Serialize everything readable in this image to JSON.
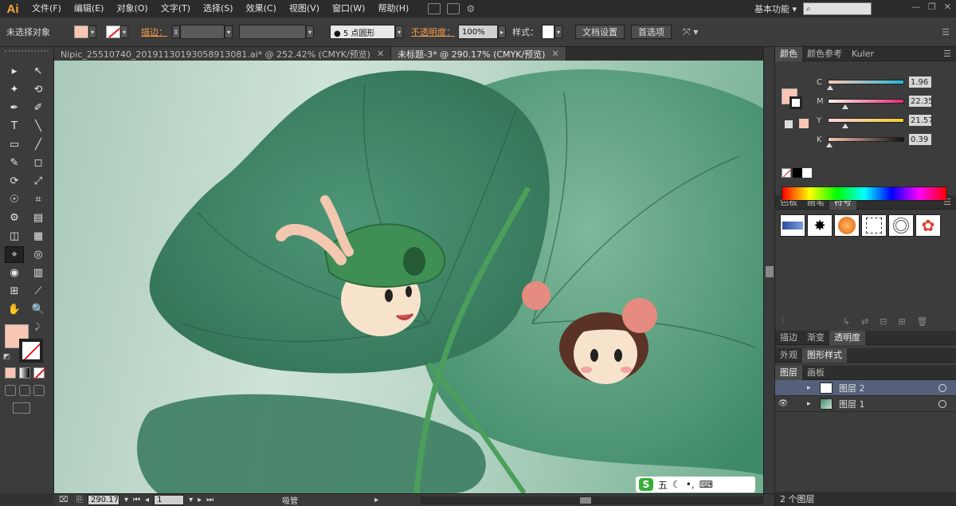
{
  "app": {
    "logo": "Ai",
    "menu": [
      "文件(F)",
      "编辑(E)",
      "对象(O)",
      "文字(T)",
      "选择(S)",
      "效果(C)",
      "视图(V)",
      "窗口(W)",
      "帮助(H)"
    ],
    "workspace": "基本功能",
    "window_buttons": [
      "—",
      "❐",
      "✕"
    ]
  },
  "control_bar": {
    "selection_status": "未选择对象",
    "stroke_label": "描边：",
    "brush_label": "● 5 点圆形",
    "opacity_label": "不透明度：",
    "opacity_value": "100%",
    "style_label": "样式：",
    "doc_setup_button": "文档设置",
    "preferences_button": "首选项"
  },
  "tabs": [
    {
      "label": "Nipic_25510740_20191130193058913081.ai* @ 252.42% (CMYK/预览)",
      "active": false
    },
    {
      "label": "未标题-3* @ 290.17% (CMYK/预览)",
      "active": true
    }
  ],
  "tools": [
    "▸",
    "↖",
    "✦",
    "⟲",
    "✒",
    "✐",
    "T",
    "╲",
    "▭",
    "╱",
    "✎",
    "◻",
    "⟳",
    "⤢",
    "☉",
    "⌗",
    "⚙",
    "▤",
    "◫",
    "▦",
    "⌖",
    "◎",
    "◉",
    "▥",
    "⊞",
    "⟋",
    "✋",
    "🔍"
  ],
  "colors": {
    "fill": "#f9c6b4",
    "stroke": "#ffffff",
    "accent_orange": "#f49a4a",
    "selected_layer_bg": "#55607a"
  },
  "status_bar": {
    "zoom": "290.17",
    "artboard": "1",
    "tool_name": "吸管"
  },
  "ime": {
    "brand": "S",
    "label": "五"
  },
  "color_panel": {
    "tabs": [
      "颜色",
      "颜色参考",
      "Kuler"
    ],
    "sliders": [
      {
        "label": "C",
        "value": "1.96",
        "level": 0.02
      },
      {
        "label": "M",
        "value": "22.35",
        "level": 0.22
      },
      {
        "label": "Y",
        "value": "21.57",
        "level": 0.22
      },
      {
        "label": "K",
        "value": "0.39",
        "level": 0.01
      }
    ]
  },
  "swatches_panel": {
    "tabs": [
      "色板",
      "画笔",
      "符号"
    ]
  },
  "appearance_panel": {
    "tabs": [
      "描边",
      "渐变",
      "透明度"
    ]
  },
  "styles_panel": {
    "tabs": [
      "外观",
      "图形样式"
    ]
  },
  "layers_panel": {
    "tabs": [
      "图层",
      "画板"
    ],
    "layers": [
      {
        "name": "图层 2",
        "selected": true
      },
      {
        "name": "图层 1",
        "selected": false
      }
    ],
    "footer": "2 个图层"
  }
}
